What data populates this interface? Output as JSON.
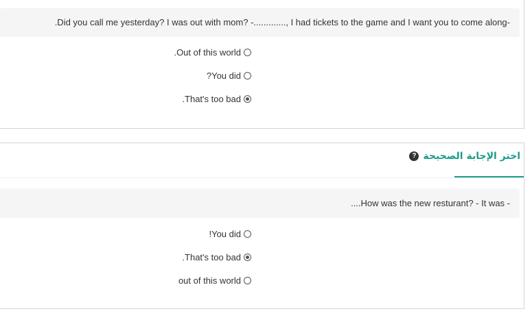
{
  "questions": [
    {
      "text": ".Did you call me yesterday? I was out with mom? -............., I had tickets to the game and I want you to come along-",
      "options": [
        {
          "label": ".Out of this world",
          "selected": false
        },
        {
          "label": "?You did",
          "selected": false
        },
        {
          "label": ".That's too bad",
          "selected": true
        }
      ]
    },
    {
      "header": "اختر الإجابة الصحيحة",
      "help_icon": "?",
      "text": "....How was the new resturant? - It was -",
      "options": [
        {
          "label": "!You did",
          "selected": false
        },
        {
          "label": ".That's too bad",
          "selected": true
        },
        {
          "label": "out of this world",
          "selected": false
        }
      ]
    }
  ],
  "colors": {
    "accent": "#1d9b88",
    "question_bg": "#f5f5f5",
    "border": "#d4d4d4"
  }
}
